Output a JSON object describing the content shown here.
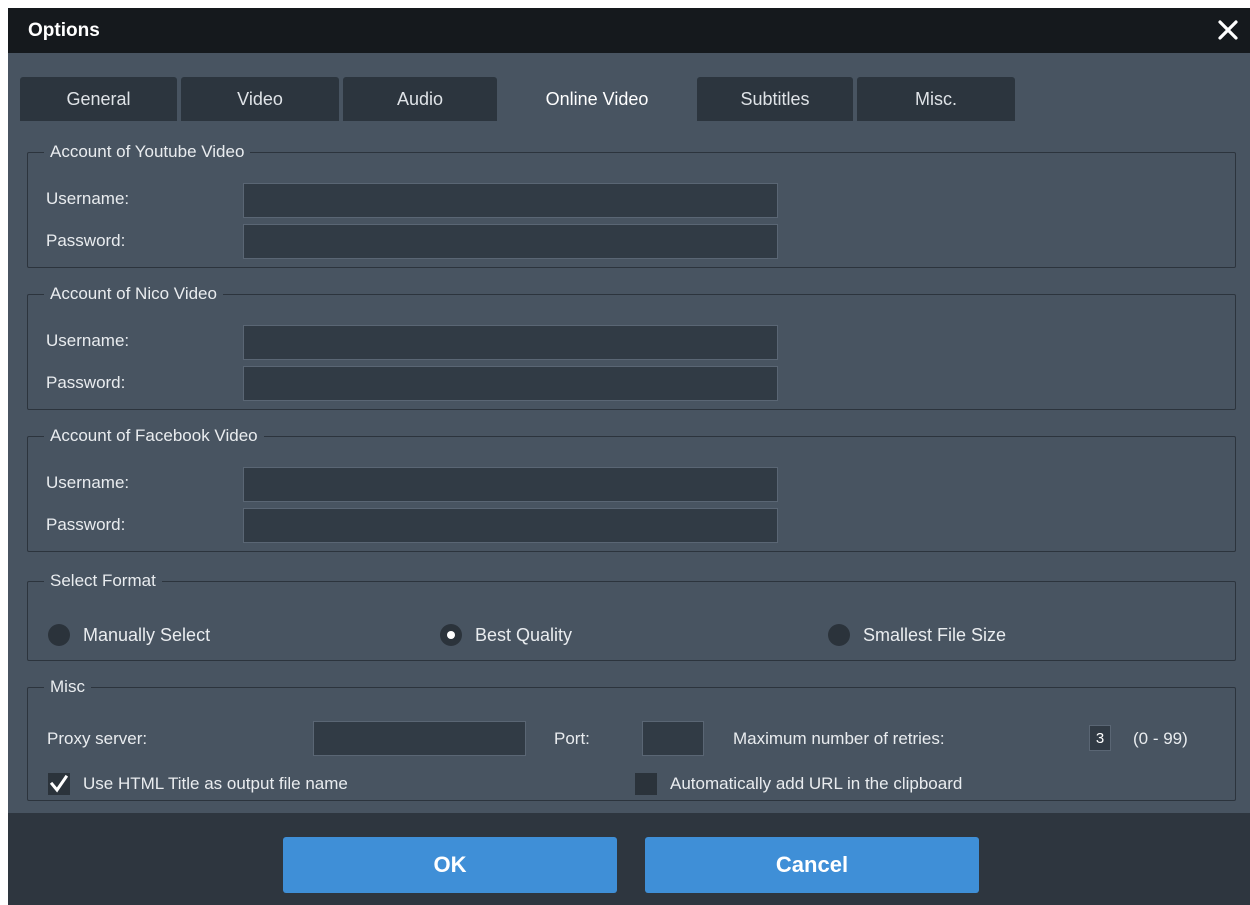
{
  "window": {
    "title": "Options"
  },
  "tabs": [
    {
      "label": "General",
      "active": false
    },
    {
      "label": "Video",
      "active": false
    },
    {
      "label": "Audio",
      "active": false
    },
    {
      "label": "Online Video",
      "active": true
    },
    {
      "label": "Subtitles",
      "active": false
    },
    {
      "label": "Misc.",
      "active": false
    }
  ],
  "accounts": {
    "youtube": {
      "title": "Account of Youtube Video",
      "username_label": "Username:",
      "password_label": "Password:",
      "username_value": "",
      "password_value": ""
    },
    "nico": {
      "title": "Account of Nico Video",
      "username_label": "Username:",
      "password_label": "Password:",
      "username_value": "",
      "password_value": ""
    },
    "facebook": {
      "title": "Account of Facebook Video",
      "username_label": "Username:",
      "password_label": "Password:",
      "username_value": "",
      "password_value": ""
    }
  },
  "format": {
    "title": "Select Format",
    "options": [
      {
        "label": "Manually Select",
        "selected": false
      },
      {
        "label": "Best Quality",
        "selected": true
      },
      {
        "label": "Smallest File Size",
        "selected": false
      }
    ]
  },
  "misc": {
    "title": "Misc",
    "proxy_label": "Proxy server:",
    "proxy_value": "",
    "port_label": "Port:",
    "port_value": "",
    "retries_label": "Maximum number of retries:",
    "retries_value": "3",
    "retries_range": "(0 - 99)",
    "use_html_title_label": "Use HTML Title as output file name",
    "use_html_title_checked": true,
    "auto_add_url_label": "Automatically add URL in the clipboard",
    "auto_add_url_checked": false
  },
  "buttons": {
    "ok": "OK",
    "cancel": "Cancel"
  },
  "colors": {
    "window_bg": "#485461",
    "titlebar_bg": "#15191d",
    "tab_bg": "#2c353e",
    "accent": "#3f8fd7",
    "footer_bg": "#2e363f"
  }
}
